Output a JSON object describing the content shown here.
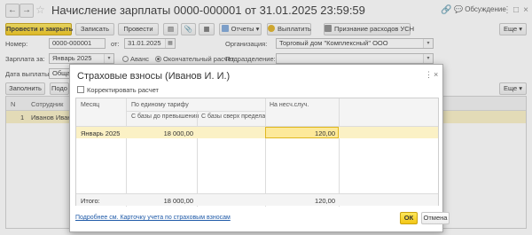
{
  "header": {
    "title": "Начисление зарплаты 0000-000001 от 31.01.2025 23:59:59",
    "discuss_label": "Обсуждение"
  },
  "toolbar": {
    "post_close": "Провести и закрыть",
    "save": "Записать",
    "post": "Провести",
    "reports": "Отчеты",
    "pay": "Выплатить",
    "usn": "Признание расходов УСН",
    "more": "Еще"
  },
  "form": {
    "number_label": "Номер:",
    "number": "0000-000001",
    "from_label": "от:",
    "date": "31.01.2025",
    "org_label": "Организация:",
    "org": "Торговый дом \"Комплексный\" ООО",
    "salary_for_label": "Зарплата за:",
    "salary_period": "Январь 2025",
    "advance_label": "Аванс",
    "final_label": "Окончательный расчет",
    "dept_label": "Подразделение:",
    "dept": "",
    "paydate_label": "Дата выплаты:",
    "paydate": "Общая"
  },
  "bg_table": {
    "fill_button": "Заполнить",
    "pick_button": "Подо",
    "more": "Еще",
    "col_n": "N",
    "col_employee": "Сотрудник",
    "row_n": "1",
    "row_employee": "Иванов Иван И"
  },
  "dialog": {
    "title": "Страховые взносы (Иванов И. И.)",
    "correct_label": "Корректировать расчет",
    "columns": {
      "month": "Месяц",
      "by_tariff": "По единому тарифу",
      "to_limit": "С базы до превышения",
      "over_limit": "С базы сверх предела",
      "accident": "На несч.случ."
    },
    "row": {
      "month": "Январь 2025",
      "to_limit": "18 000,00",
      "over_limit": "",
      "accident": "120,00"
    },
    "totals": {
      "label": "Итого:",
      "to_limit": "18 000,00",
      "accident": "120,00"
    },
    "link": "Подробнее см. Карточку учета по страховым взносам",
    "ok": "ОК",
    "cancel": "Отмена"
  },
  "colors": {
    "accent_yellow": "#f3c615",
    "selected_row": "#fbf1c5",
    "active_cell": "#fde99a"
  }
}
